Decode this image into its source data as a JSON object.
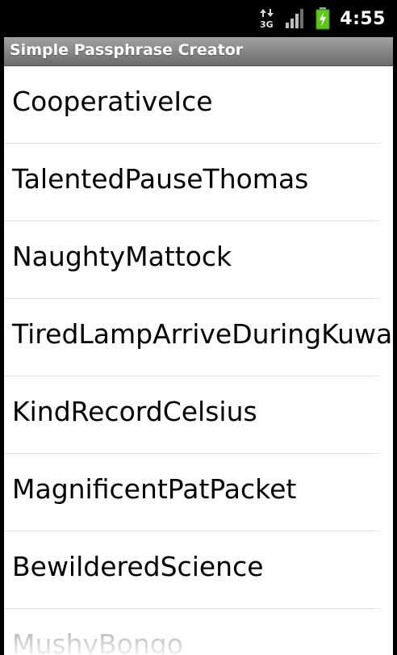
{
  "status_bar": {
    "network_type": "3G",
    "time": "4:55",
    "icons": [
      "data-transfer-icon",
      "signal-strength-icon",
      "battery-charging-icon"
    ]
  },
  "app": {
    "title": "Simple Passphrase Creator"
  },
  "passphrases": [
    "CooperativeIce",
    "TalentedPauseThomas",
    "NaughtyMattock",
    "TiredLampArriveDuringKuwait",
    "KindRecordCelsius",
    "MagnificentPatPacket",
    "BewilderedScience",
    "MushyBongo"
  ],
  "colors": {
    "title_bar": "#8a8a8a",
    "list_background": "#ffffff",
    "divider": "#e3e3e3",
    "battery_green": "#5cc81c"
  }
}
